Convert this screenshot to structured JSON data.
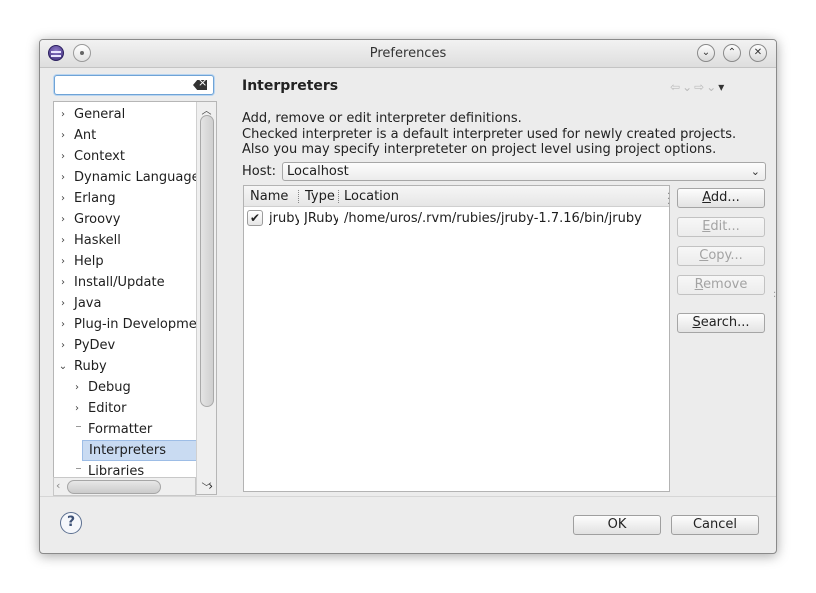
{
  "window": {
    "title": "Preferences",
    "controls": {
      "minimize": "⌄",
      "maximize": "⌃",
      "close": "✕"
    }
  },
  "sidebar": {
    "filter": {
      "value": "",
      "placeholder": ""
    },
    "items": [
      {
        "label": "General",
        "expander": "›"
      },
      {
        "label": "Ant",
        "expander": "›"
      },
      {
        "label": "Context",
        "expander": "›"
      },
      {
        "label": "Dynamic Languages",
        "expander": "›"
      },
      {
        "label": "Erlang",
        "expander": "›"
      },
      {
        "label": "Groovy",
        "expander": "›"
      },
      {
        "label": "Haskell",
        "expander": "›"
      },
      {
        "label": "Help",
        "expander": "›"
      },
      {
        "label": "Install/Update",
        "expander": "›"
      },
      {
        "label": "Java",
        "expander": "›"
      },
      {
        "label": "Plug-in Development",
        "expander": "›"
      },
      {
        "label": "PyDev",
        "expander": "›"
      },
      {
        "label": "Ruby",
        "expander": "⌄"
      }
    ],
    "ruby_children": [
      {
        "label": "Debug",
        "expander": "›"
      },
      {
        "label": "Editor",
        "expander": "›"
      },
      {
        "label": "Formatter",
        "expander": ""
      },
      {
        "label": "Interpreters",
        "expander": "",
        "selected": true
      },
      {
        "label": "Libraries",
        "expander": ""
      }
    ]
  },
  "main": {
    "title": "Interpreters",
    "description": [
      "Add, remove or edit interpreter definitions.",
      "Checked interpreter is a default interpreter used for newly created projects.",
      "Also you may specify interpreteter on project level using project options."
    ],
    "host": {
      "label": "Host:",
      "value": "Localhost"
    },
    "table": {
      "columns": [
        "Name",
        "Type",
        "Location"
      ],
      "rows": [
        {
          "checked": true,
          "name": "jruby",
          "type": "JRuby",
          "location": "/home/uros/.rvm/rubies/jruby-1.7.16/bin/jruby"
        }
      ]
    },
    "buttons": {
      "add": {
        "mnemonic": "A",
        "rest": "dd..."
      },
      "edit": {
        "mnemonic": "E",
        "rest": "dit..."
      },
      "copy": {
        "mnemonic": "C",
        "rest": "opy..."
      },
      "remove": {
        "mnemonic": "R",
        "rest": "emove"
      },
      "search": {
        "mnemonic": "S",
        "rest": "earch..."
      }
    }
  },
  "footer": {
    "ok_label": "OK",
    "cancel_label": "Cancel",
    "help": "?"
  }
}
